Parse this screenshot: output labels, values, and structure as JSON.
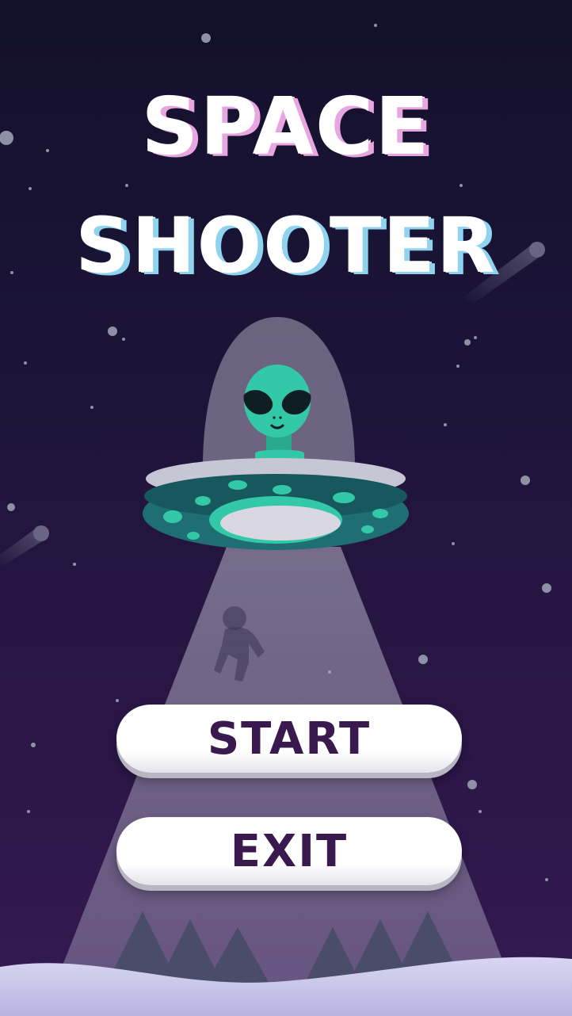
{
  "title": {
    "line1": "SPACE",
    "line2": "SHOOTER"
  },
  "menu": {
    "start_label": "START",
    "exit_label": "EXIT"
  },
  "icons": {
    "ufo": "ufo-icon",
    "alien": "alien-icon",
    "astronaut": "astronaut-silhouette-icon",
    "trees": "pine-tree-icon",
    "meteor": "meteor-icon"
  },
  "colors": {
    "background_top": "#12102a",
    "background_bottom": "#341a52",
    "alien_green": "#33c9a8",
    "ufo_teal": "#1f6e73",
    "button_text": "#3a1a4e",
    "title_pink_shadow": "#e8a6e0",
    "title_blue_shadow": "#8fd3ee"
  }
}
